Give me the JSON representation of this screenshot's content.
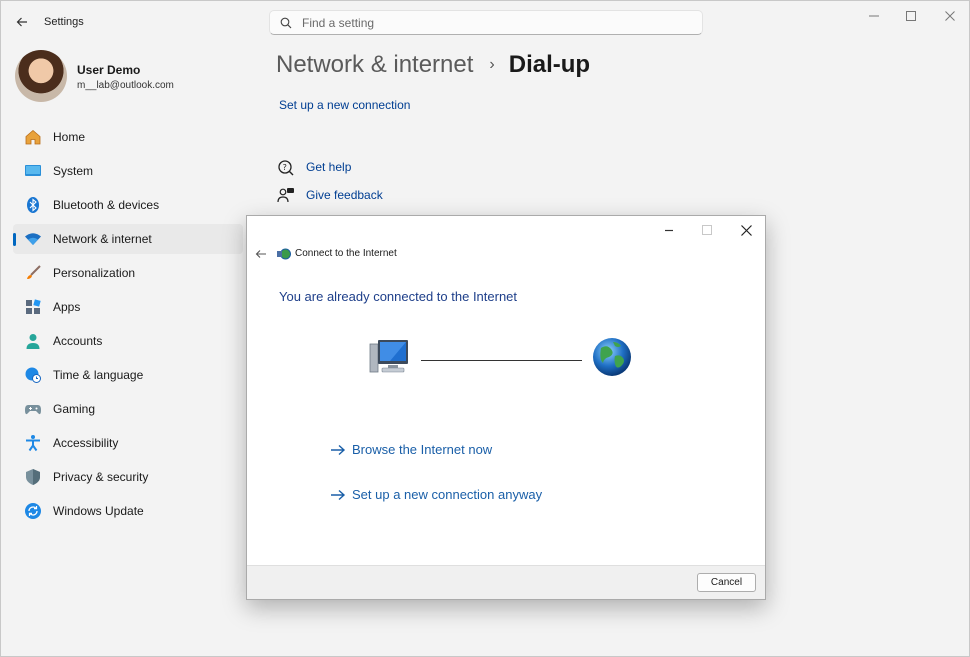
{
  "app": {
    "title": "Settings"
  },
  "search": {
    "placeholder": "Find a setting"
  },
  "profile": {
    "name": "User Demo",
    "email": "m__lab@outlook.com"
  },
  "sidebar": {
    "items": [
      {
        "label": "Home",
        "icon": "home-icon"
      },
      {
        "label": "System",
        "icon": "monitor-icon"
      },
      {
        "label": "Bluetooth & devices",
        "icon": "bluetooth-icon"
      },
      {
        "label": "Network & internet",
        "icon": "wifi-icon",
        "active": true
      },
      {
        "label": "Personalization",
        "icon": "brush-icon"
      },
      {
        "label": "Apps",
        "icon": "apps-icon"
      },
      {
        "label": "Accounts",
        "icon": "person-icon"
      },
      {
        "label": "Time & language",
        "icon": "clock-globe-icon"
      },
      {
        "label": "Gaming",
        "icon": "gamepad-icon"
      },
      {
        "label": "Accessibility",
        "icon": "accessibility-icon"
      },
      {
        "label": "Privacy & security",
        "icon": "shield-icon"
      },
      {
        "label": "Windows Update",
        "icon": "update-icon"
      }
    ]
  },
  "breadcrumb": {
    "parent": "Network & internet",
    "separator": "›",
    "current": "Dial-up"
  },
  "main": {
    "setup_link": "Set up a new connection",
    "get_help": "Get help",
    "give_feedback": "Give feedback"
  },
  "dialog": {
    "title": "Connect to the Internet",
    "heading": "You are already connected to the Internet",
    "links": [
      "Browse the Internet now",
      "Set up a new connection anyway"
    ],
    "cancel": "Cancel"
  },
  "colors": {
    "accent": "#0067c0",
    "link": "#003e92",
    "dialog_link": "#1a5fa8"
  }
}
